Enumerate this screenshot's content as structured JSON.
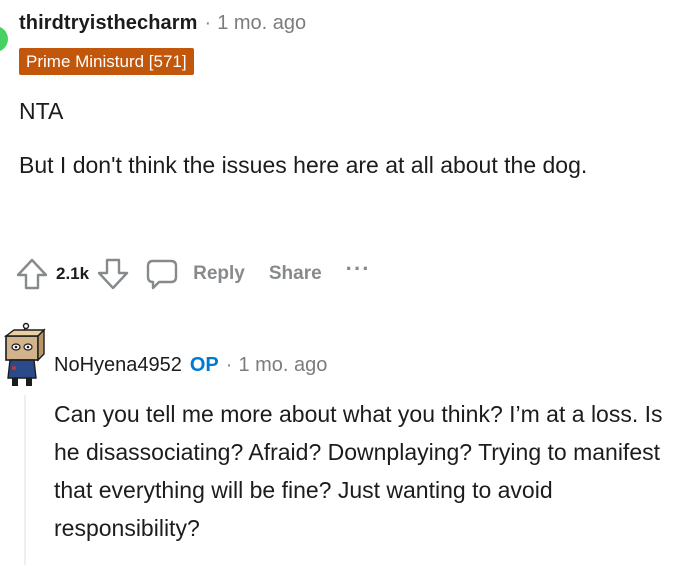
{
  "comment": {
    "username": "thirdtryisthecharm",
    "separator": "·",
    "time": "1 mo. ago",
    "flair": "Prime Ministurd [571]",
    "body": [
      "NTA",
      "But I don't think the issues here are at all about the dog."
    ],
    "actions": {
      "score": "2.1k",
      "reply_label": "Reply",
      "share_label": "Share",
      "more_label": "···"
    }
  },
  "reply": {
    "username": "NoHyena4952",
    "op_badge": "OP",
    "separator": "·",
    "time": "1 mo. ago",
    "body": "Can you tell me more about what you think? I’m at a loss. Is he disassociating? Afraid? Downplaying? Trying to manifest that everything will be fine? Just wanting to avoid responsibility?"
  },
  "icons": {
    "avatar_color": "#46d160",
    "flair_color": "#c2570c",
    "op_color": "#0079d3",
    "upvote": "upvote-arrow-icon",
    "downvote": "downvote-arrow-icon",
    "reply": "speech-bubble-icon",
    "avatar2": "snoo-avatar-icon"
  }
}
